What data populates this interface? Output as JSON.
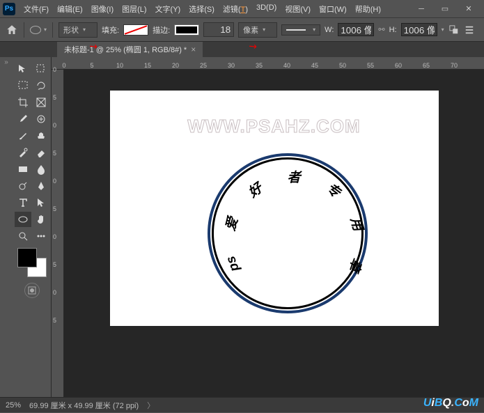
{
  "app": {
    "logo": "Ps"
  },
  "menus": [
    {
      "label": "文件(F)",
      "name": "menu-file"
    },
    {
      "label": "编辑(E)",
      "name": "menu-edit"
    },
    {
      "label": "图像(I)",
      "name": "menu-image"
    },
    {
      "label": "图层(L)",
      "name": "menu-layer"
    },
    {
      "label": "文字(Y)",
      "name": "menu-type"
    },
    {
      "label": "选择(S)",
      "name": "menu-select"
    },
    {
      "label": "滤镜(T)",
      "name": "menu-filter",
      "hot": "T"
    },
    {
      "label": "3D(D)",
      "name": "menu-3d"
    },
    {
      "label": "视图(V)",
      "name": "menu-view"
    },
    {
      "label": "窗口(W)",
      "name": "menu-window"
    },
    {
      "label": "帮助(H)",
      "name": "menu-help"
    }
  ],
  "options": {
    "mode": "形状",
    "fill_label": "填充:",
    "stroke_label": "描边:",
    "stroke_width": "18",
    "stroke_unit": "像素",
    "w_label": "W:",
    "w_value": "1006 像",
    "h_label": "H:",
    "h_value": "1006 像"
  },
  "doc_tab": {
    "title": "未标题-1 @ 25% (椭圆 1, RGB/8#) *"
  },
  "hruler_ticks": [
    "0",
    "5",
    "10",
    "15",
    "20",
    "25",
    "30",
    "35",
    "40",
    "45",
    "50",
    "55",
    "60",
    "65",
    "70"
  ],
  "vruler_ticks": [
    "0",
    "5",
    "0",
    "5",
    "0",
    "5",
    "0",
    "5",
    "0",
    "5"
  ],
  "canvas": {
    "watermark": "WWW.PSAHZ.COM",
    "curve_chars": [
      "ps",
      "爱",
      "好",
      "者",
      "专",
      "用",
      "章"
    ]
  },
  "status": {
    "zoom": "25%",
    "dims": "69.99 厘米 x 49.99 厘米 (72 ppi)"
  },
  "brand": {
    "text": "UiBQ.CoM"
  }
}
